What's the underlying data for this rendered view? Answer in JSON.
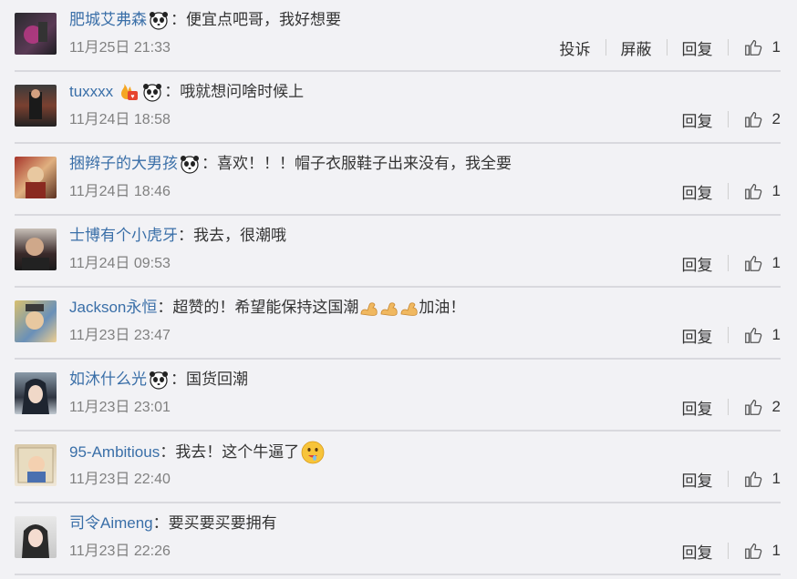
{
  "comments": [
    {
      "user": "肥城艾弗森",
      "badges": [
        "panda"
      ],
      "text": "便宜点吧哥，我好想要",
      "time": "11月25日 21:33",
      "report": "投诉",
      "block": "屏蔽",
      "reply": "回复",
      "likes": "1"
    },
    {
      "user": "tuxxxx",
      "badges": [
        "flame",
        "panda"
      ],
      "text": "哦就想问啥时候上",
      "time": "11月24日 18:58",
      "reply": "回复",
      "likes": "2"
    },
    {
      "user": "捆辫子的大男孩",
      "badges": [
        "panda"
      ],
      "text": "喜欢！！！帽子衣服鞋子出来没有，我全要",
      "time": "11月24日 18:46",
      "reply": "回复",
      "likes": "1"
    },
    {
      "user": "士博有个小虎牙",
      "badges": [],
      "text": "我去，很潮哦",
      "time": "11月24日 09:53",
      "reply": "回复",
      "likes": "1"
    },
    {
      "user": "Jackson永恒",
      "badges": [],
      "text": "超赞的！希望能保持这国潮",
      "text_suffix": "加油！",
      "time": "11月23日 23:47",
      "reply": "回复",
      "likes": "1"
    },
    {
      "user": "如沐什么光",
      "badges": [
        "panda"
      ],
      "text": "国货回潮",
      "time": "11月23日 23:01",
      "reply": "回复",
      "likes": "2"
    },
    {
      "user": "95-Ambitious",
      "badges": [],
      "text": "我去！这个牛逼了",
      "time": "11月23日 22:40",
      "reply": "回复",
      "likes": "1"
    },
    {
      "user": "司令Aimeng",
      "badges": [],
      "text": "要买要买要拥有",
      "time": "11月23日 22:26",
      "reply": "回复",
      "likes": "1"
    }
  ],
  "separator": "：",
  "icons": {
    "like": "thumbs-up-icon",
    "panda": "panda-badge-icon",
    "flame": "flame-badge-icon",
    "muscle": "flexed-biceps-emoji",
    "drool": "drooling-face-emoji"
  },
  "colors": {
    "username": "#3a6fa8",
    "time": "#808080",
    "background": "#f2f2f5",
    "divider": "#d9d9de"
  }
}
